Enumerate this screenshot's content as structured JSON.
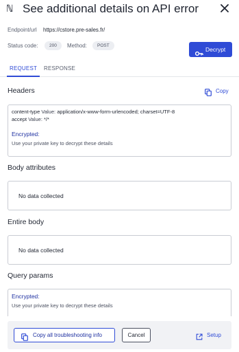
{
  "header": {
    "logo_icon": "logo-icon",
    "title": "See additional details on API error",
    "close_icon": "close-icon"
  },
  "meta": {
    "endpoint_label": "Endpoint/url",
    "endpoint_value": "https://cstore.pre-sales.fr/",
    "status_label": "Status code:",
    "status_value": "200",
    "method_label": "Method:",
    "method_value": "POST"
  },
  "decrypt_button": {
    "icon": "key-icon",
    "label": "Decrypt"
  },
  "tabs": [
    {
      "label": "REQUEST",
      "active": true
    },
    {
      "label": "RESPONSE",
      "active": false
    }
  ],
  "headers_section": {
    "title": "Headers",
    "copy_icon": "copy-icon",
    "copy_label": "Copy",
    "lines": [
      {
        "key": "content-type",
        "value_prefix": "Value:",
        "value": "application/x-www-form-urlencoded; charset=UTF-8"
      },
      {
        "key": "accept",
        "value_prefix": "Value:",
        "value": "*/*"
      }
    ],
    "encrypted_title": "Encrypted:",
    "encrypted_desc": "Use your private key to decrypt these details"
  },
  "body_attributes": {
    "title": "Body attributes",
    "empty": "No data collected"
  },
  "entire_body": {
    "title": "Entire body",
    "empty": "No data collected"
  },
  "query_params": {
    "title": "Query params",
    "encrypted_title": "Encrypted:",
    "encrypted_desc": "Use your private key to decrypt these details"
  },
  "footer": {
    "copy_all_icon": "copy-icon",
    "copy_all_label": "Copy all troubleshooting info",
    "cancel_label": "Cancel",
    "setup_icon": "external-link-icon",
    "setup_label": "Setup"
  },
  "colors": {
    "accent": "#2f4bd6",
    "encrypted_text": "#1d2fa0",
    "footer_bg": "#f1f2f5"
  }
}
